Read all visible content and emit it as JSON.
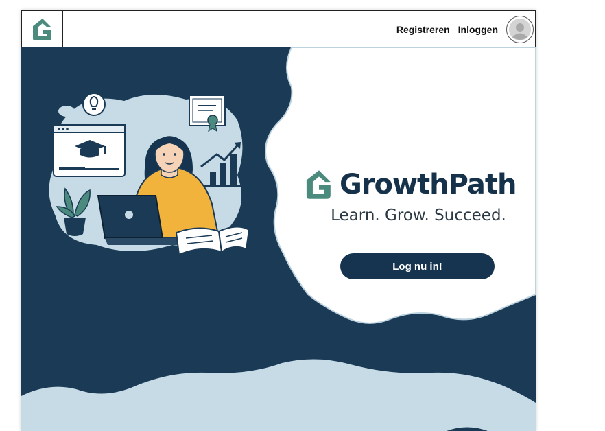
{
  "header": {
    "logo_icon": "growthpath-g-logo-icon",
    "nav": {
      "register_label": "Registreren",
      "login_label": "Inloggen"
    },
    "avatar_icon": "user-avatar-icon"
  },
  "hero": {
    "brand_name": "GrowthPath",
    "tagline": "Learn. Grow. Succeed.",
    "cta_label": "Log nu in!",
    "illustration": "woman-studying-online-illustration"
  },
  "colors": {
    "navy": "#1a3a55",
    "teal": "#4a8b7d",
    "light_blue": "#c6dbe5",
    "button": "#16344f"
  }
}
